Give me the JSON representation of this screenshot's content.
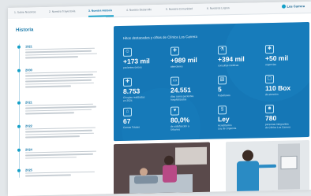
{
  "nav": {
    "tabs": [
      {
        "label": "1. Sobre Nosotros",
        "active": false
      },
      {
        "label": "2. Nuestra Trayectoria",
        "active": false
      },
      {
        "label": "3. Nuestra Historia",
        "active": true
      },
      {
        "label": "4. Nuestro Desarrollo",
        "active": false
      },
      {
        "label": "5. Nuestra Comunidad",
        "active": false
      },
      {
        "label": "6. Nuestros Logros",
        "active": false
      }
    ],
    "brand": "Los Carrera",
    "accent_color": "#14a0c8"
  },
  "history": {
    "title": "Historia",
    "items": [
      {
        "year": "1921"
      },
      {
        "year": "2000"
      },
      {
        "year": "2021"
      },
      {
        "year": "2022"
      },
      {
        "year": "2024"
      },
      {
        "year": "2025"
      }
    ]
  },
  "stats": {
    "title": "Hitos destacados y cifras de Clínica Los Carrera",
    "panel_color": "#1577b6",
    "items": [
      {
        "icon": "patients-icon",
        "value": "+173 mil",
        "label": "pacientes únicos"
      },
      {
        "icon": "care-icon",
        "value": "+989 mil",
        "label": "atenciones"
      },
      {
        "icon": "lab-icon",
        "value": "+394 mil",
        "label": "consultas médicas"
      },
      {
        "icon": "surgery-icon",
        "value": "+50 mil",
        "label": "urgencias"
      },
      {
        "icon": "doctor-icon",
        "value": "8.753",
        "label": "Cirugías realizadas",
        "label2": "en 2024"
      },
      {
        "icon": "bed-icon",
        "value": "24.551",
        "label": "días cama pacientes",
        "label2": "hospitalizados"
      },
      {
        "icon": "building-icon",
        "value": "5",
        "label": "Pabellones"
      },
      {
        "icon": "box-icon",
        "value": "110 Box",
        "label": "de atención"
      },
      {
        "icon": "clinic-icon",
        "value": "67",
        "label": "Camas Totales"
      },
      {
        "icon": "heart-icon",
        "value": "80,0%",
        "label": "de satisfacción a",
        "label2": "Urbanos"
      },
      {
        "icon": "law-icon",
        "value": "Ley",
        "label": "Acreditación",
        "label2": "Ley de Urgencia"
      },
      {
        "icon": "staff-icon",
        "value": "780",
        "label": "personas integrantes",
        "label2": "de Clínica Los Carrera"
      }
    ]
  },
  "photos": [
    {
      "alt": "nurse-with-patient-photo"
    },
    {
      "alt": "xray-technician-photo"
    }
  ]
}
